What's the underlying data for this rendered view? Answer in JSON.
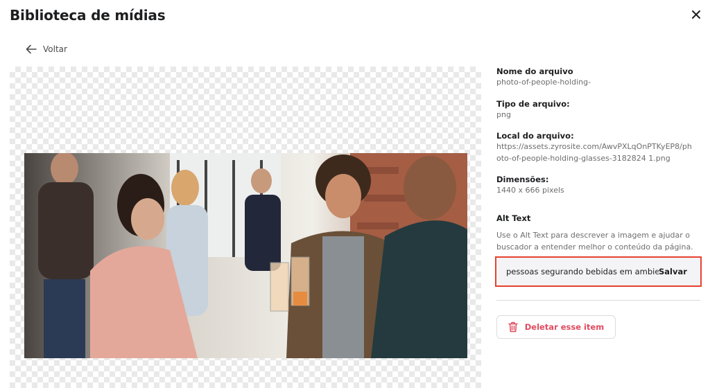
{
  "header": {
    "title": "Biblioteca de mídias"
  },
  "nav": {
    "back_label": "Voltar"
  },
  "file": {
    "name_label": "Nome do arquivo",
    "name_value": "photo-of-people-holding-",
    "type_label": "Tipo de arquivo:",
    "type_value": "png",
    "location_label": "Local do arquivo:",
    "location_line1": "https://assets.zyrosite.com/AwvPXLqOnPTKyEP8/ph",
    "location_line2": "oto-of-people-holding-glasses-3182824 1.png",
    "dimensions_label": "Dimensões:",
    "dimensions_value": "1440 x 666 pixels"
  },
  "alt_text": {
    "label": "Alt Text",
    "help_line1": "Use o Alt Text para descrever a imagem e ajudar o",
    "help_line2": "buscador a entender melhor o conteúdo da página.",
    "value": "pessoas segurando bebidas em ambien",
    "save_label": "Salvar"
  },
  "actions": {
    "delete_label": "Deletar esse item"
  },
  "colors": {
    "highlight_border": "#e8402f",
    "delete_text": "#e04a5f",
    "field_bg": "#f4f4f7"
  }
}
